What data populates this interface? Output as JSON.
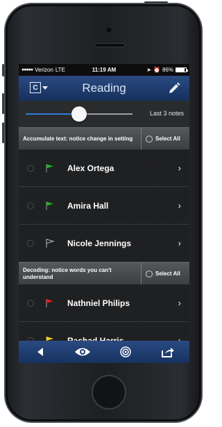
{
  "status": {
    "carrier": "Verizon",
    "network": "LTE",
    "time": "11:19 AM",
    "battery": "86%",
    "battery_level": 0.86
  },
  "nav": {
    "class_icon_label": "C",
    "title": "Reading"
  },
  "filter": {
    "slider_level": 0.5,
    "label": "Last 3 notes"
  },
  "sections": [
    {
      "title": "Accumulate text: notice change in setting",
      "select_all": "Select All",
      "students": [
        {
          "name": "Alex Ortega",
          "flag_color": "#22b22b"
        },
        {
          "name": "Amira Hall",
          "flag_color": "#22b22b"
        },
        {
          "name": "Nicole Jennings",
          "flag_color": "none"
        }
      ]
    },
    {
      "title": "Decoding: notice words you can't understand",
      "select_all": "Select All",
      "students": [
        {
          "name": "Nathniel Philips",
          "flag_color": "#e01e1e"
        },
        {
          "name": "Rashad Harris",
          "flag_color": "#f2d21b"
        }
      ]
    }
  ],
  "toolbar": {
    "icons": [
      "back-arrow-icon",
      "eye-icon",
      "target-icon",
      "share-icon"
    ]
  },
  "colors": {
    "nav_blue": "#1f3d70",
    "accent": "#2e7bd6"
  }
}
